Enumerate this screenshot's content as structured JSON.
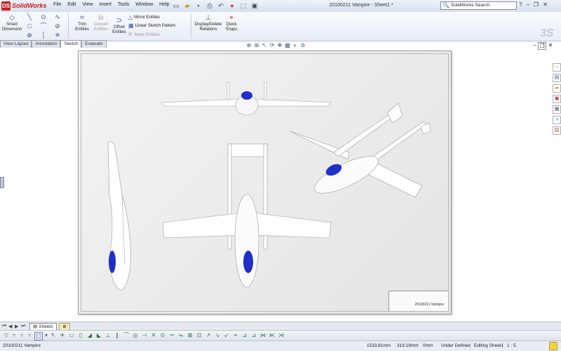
{
  "app": {
    "name": "SolidWorks",
    "logo_letters": "DS"
  },
  "menu": [
    "File",
    "Edit",
    "View",
    "Insert",
    "Tools",
    "Window",
    "Help"
  ],
  "window": {
    "title": "20100211 Vampire - Sheet1 *"
  },
  "search": {
    "placeholder": "SolidWorks Search"
  },
  "window_controls": {
    "help": "?",
    "minimize": "–",
    "restore": "❐",
    "close": "✕"
  },
  "commands": {
    "smart_dimension": "Smart\nDimension",
    "trim_entities": "Trim\nEntities",
    "convert_entities": "Convert\nEntities",
    "offset_entities": "Offset\nEntities",
    "mirror_entities": "Mirror Entities",
    "linear_sketch_pattern": "Linear Sketch Pattern",
    "move_entities": "Move Entities",
    "display_delete_relations": "Display/Delete\nRelations",
    "quick_snaps": "Quick\nSnaps"
  },
  "tabs": [
    {
      "label": "View Layout",
      "active": false
    },
    {
      "label": "Annotation",
      "active": false
    },
    {
      "label": "Sketch",
      "active": true
    },
    {
      "label": "Evaluate",
      "active": false
    }
  ],
  "sheet": {
    "title_block_name": "20100211 Vampire"
  },
  "sheet_tab": {
    "label": "Sheet1"
  },
  "status": {
    "document": "20100211 Vampire",
    "x": "1533.81mm",
    "y": "319.19mm",
    "z": "0mm",
    "state": "Under Defined",
    "editing": "Editing Sheet1",
    "scale": "1 : 5"
  },
  "colors": {
    "accent": "#c8201d",
    "canopy": "#1f2fc8",
    "toolbar_icon": "#2d7a3c"
  },
  "icons": {
    "task_pane": [
      "home-icon",
      "design-library-icon",
      "file-explorer-icon",
      "view-palette-icon",
      "appearances-icon",
      "custom-properties-icon",
      "color-icon"
    ]
  }
}
